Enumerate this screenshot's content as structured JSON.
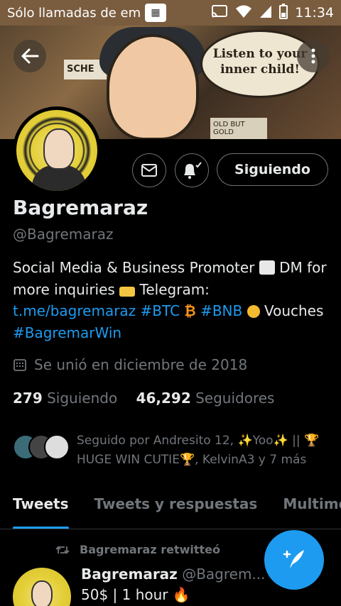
{
  "status_bar": {
    "carrier": "Sólo llamadas de em",
    "time": "11:34"
  },
  "banner": {
    "bubble_text_1": "Listen to your",
    "bubble_text_2": "inner child!",
    "sign_text": "SCHE",
    "poster_text": "OLD BUT GOLD"
  },
  "profile": {
    "follow_label": "Siguiendo",
    "name": "Bagremaraz",
    "handle": "@Bagremaraz",
    "bio": {
      "part1": "Social Media & Business Promoter ",
      "part2": " DM for more inquiries ",
      "part3": " Telegram: ",
      "link_tme": "t.me/bagremaraz",
      "tag_btc": "#BTC",
      "tag_bnb": "#BNB",
      "part4": " Vouches ",
      "tag_win": "#BagremarWin"
    },
    "joined": "Se unió en diciembre de 2018",
    "following_count": "279",
    "following_label": "Siguiendo",
    "followers_count": "46,292",
    "followers_label": "Seguidores",
    "followed_by": "Seguido por Andresito 12, ✨Yoo✨ || 🏆 HUGE WIN CUTIE🏆, KelvinA3 y 7 más"
  },
  "tabs": [
    {
      "label": "Tweets"
    },
    {
      "label": "Tweets y respuestas"
    },
    {
      "label": "Multimedia"
    }
  ],
  "tweet": {
    "retweet_label": "Bagremaraz retwitteó",
    "author": "Bagremaraz",
    "author_handle": "@Bagrem...",
    "text": "50$ | 1 hour 🔥"
  },
  "colors": {
    "accent": "#1d9bf0",
    "status_bar": "#7a5c3e"
  }
}
